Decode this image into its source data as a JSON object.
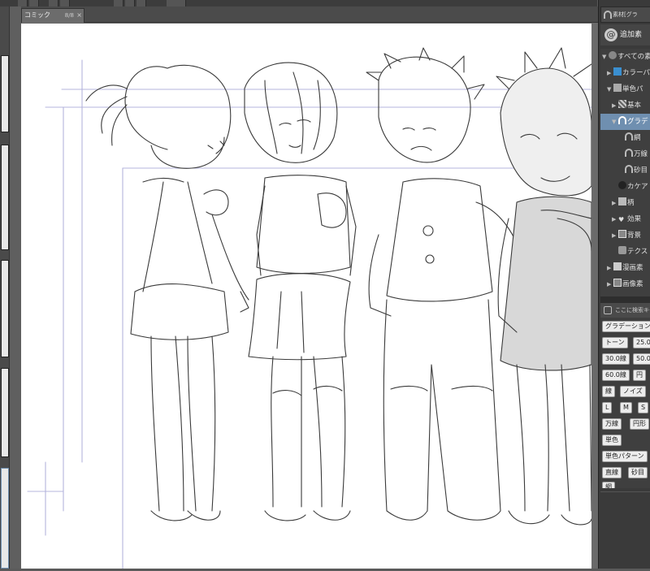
{
  "document_tab": {
    "title": "コミック",
    "zoom": "8/8",
    "close": "×"
  },
  "material_palette": {
    "tab_title": "素材[グラ",
    "add_material": "追加素",
    "tree": [
      {
        "label": "すべての素",
        "indent": 0,
        "icon": "material-icon",
        "expanded": true
      },
      {
        "label": "カラーパ",
        "indent": 1,
        "icon": "color-pattern-icon",
        "expanded": false
      },
      {
        "label": "単色パ",
        "indent": 1,
        "icon": "mono-pattern-icon",
        "expanded": true
      },
      {
        "label": "基本",
        "indent": 2,
        "icon": "checker-icon",
        "expanded": false
      },
      {
        "label": "グラデ",
        "indent": 2,
        "icon": "gradient-icon",
        "expanded": true,
        "selected": true
      },
      {
        "label": "網",
        "indent": 3,
        "icon": "gradient-icon"
      },
      {
        "label": "万線",
        "indent": 3,
        "icon": "gradient-icon"
      },
      {
        "label": "砂目",
        "indent": 3,
        "icon": "gradient-icon"
      },
      {
        "label": "カケア",
        "indent": 2,
        "icon": "dot-icon"
      },
      {
        "label": "柄",
        "indent": 1,
        "icon": "pattern-icon",
        "expanded": false
      },
      {
        "label": "効果",
        "indent": 1,
        "icon": "heart-icon",
        "expanded": false
      },
      {
        "label": "背景",
        "indent": 1,
        "icon": "image-icon",
        "expanded": false
      },
      {
        "label": "テクス",
        "indent": 1,
        "icon": "texture-icon"
      },
      {
        "label": "漫画素",
        "indent": 0,
        "icon": "manga-icon",
        "expanded": false
      },
      {
        "label": "画像素",
        "indent": 0,
        "icon": "image-icon",
        "expanded": false
      }
    ]
  },
  "search_tags": {
    "header": "ここに検索キー",
    "tags": [
      "グラデーション",
      "トーン",
      "25.0",
      "30.0線",
      "50.0",
      "60.0線",
      "円",
      "線",
      "ノイズ",
      "L",
      "M",
      "S",
      "万線",
      "円形",
      "単色",
      "単色パターン",
      "直線",
      "砂目",
      "網"
    ]
  },
  "colors": {
    "panel_bg": "#3a3a3a",
    "selected_row": "#6f8fb0",
    "canvas_bg": "#ffffff",
    "guide_line": "#b4b4dc"
  }
}
